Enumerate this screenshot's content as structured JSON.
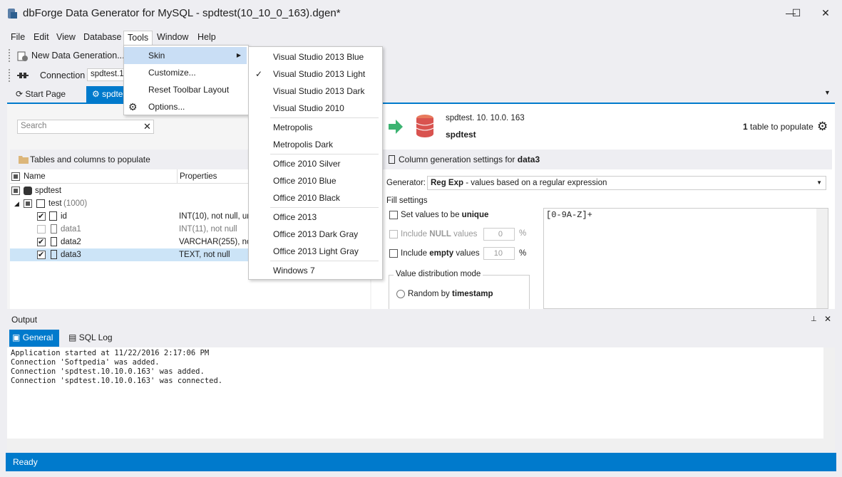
{
  "window": {
    "title": "dbForge Data Generator for MySQL - spdtest(10_10_0_163).dgen*",
    "minimize": "—",
    "maximize": "☐",
    "close": "✕"
  },
  "menu": {
    "file": "File",
    "edit": "Edit",
    "view": "View",
    "database": "Database",
    "tools": "Tools",
    "window": "Window",
    "help": "Help"
  },
  "toolbar": {
    "new_generation": "New Data Generation...",
    "connection_label": "Connection",
    "connection_value": "spdtest.10"
  },
  "tabs": {
    "start_page": "Start Page",
    "doc_tab": "spdte"
  },
  "tools_menu": {
    "items": [
      "Skin",
      "Customize...",
      "Reset Toolbar Layout",
      "Options..."
    ]
  },
  "skin_menu": {
    "items": [
      "Visual Studio 2013 Blue",
      "Visual Studio 2013 Light",
      "Visual Studio 2013 Dark",
      "Visual Studio 2010",
      "Metropolis",
      "Metropolis Dark",
      "Office 2010 Silver",
      "Office 2010 Blue",
      "Office 2010 Black",
      "Office 2013",
      "Office 2013 Dark Gray",
      "Office 2013 Light Gray",
      "Windows 7"
    ],
    "checked": "Visual Studio 2013 Light"
  },
  "left": {
    "search_placeholder": "Search",
    "section_title": "Tables and columns to populate",
    "col_name": "Name",
    "col_props": "Properties",
    "rows": [
      {
        "name": "spdtest",
        "props": ""
      },
      {
        "name": "test",
        "extra": "(1000)",
        "props": ""
      },
      {
        "name": "id",
        "props": "INT(10), not null, un"
      },
      {
        "name": "data1",
        "props": "INT(11), not null"
      },
      {
        "name": "data2",
        "props": "VARCHAR(255), not"
      },
      {
        "name": "data3",
        "props": "TEXT, not null"
      }
    ]
  },
  "right": {
    "conn_host": "spdtest. 10. 10.0. 163",
    "db_name": "spdtest",
    "tables_count": "1",
    "tables_label": "table to populate",
    "col_settings_label": "Column generation settings for",
    "col_settings_target": "data3",
    "generator_label": "Generator:",
    "generator_name": "Reg Exp",
    "generator_desc": " - values based on a regular expression",
    "fill_settings": "Fill settings",
    "unique_pre": "Set values to be ",
    "unique_bold": "unique",
    "include_null_pre": "Include ",
    "include_null_bold": "NULL",
    "include_null_post": " values",
    "null_value": "0",
    "empty_pre": "Include ",
    "empty_bold": "empty",
    "empty_post": " values",
    "empty_value": "10",
    "percent": "%",
    "regex": "[0-9A-Z]+",
    "value_dist_label": "Value distribution mode",
    "random_pre": "Random by ",
    "random_bold": "timestamp"
  },
  "output": {
    "title": "Output",
    "tab_general": "General",
    "tab_sql_log": "SQL Log",
    "log": "Application started at 11/22/2016 2:17:06 PM\nConnection 'Softpedia' was added.\nConnection 'spdtest.10.10.0.163' was added.\nConnection 'spdtest.10.10.0.163' was connected."
  },
  "status": {
    "text": "Ready"
  },
  "colors": {
    "accent": "#007acc",
    "highlight": "#c9def5",
    "selection": "#cce4f7"
  }
}
